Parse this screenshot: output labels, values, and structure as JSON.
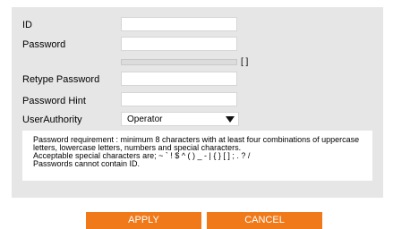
{
  "form": {
    "id_label": "ID",
    "password_label": "Password",
    "strength_label": "[ ]",
    "retype_label": "Retype Password",
    "hint_label": "Password Hint",
    "authority_label": "UserAuthority",
    "authority_value": "Operator",
    "id_value": "",
    "password_value": "",
    "retype_value": "",
    "hint_value": ""
  },
  "requirements": {
    "line1": "Password requirement : minimum 8 characters with at least four combinations of uppercase",
    "line2": "letters, lowercase letters, numbers and special characters.",
    "line3": "Acceptable special characters are; ~ ` ! $ ^ ( ) _ - | { } [ ] ; . ? /",
    "line4": "Passwords cannot contain ID."
  },
  "buttons": {
    "apply": "APPLY",
    "cancel": "CANCEL"
  },
  "colors": {
    "accent": "#f07a1a",
    "panel": "#e6e6e6"
  }
}
